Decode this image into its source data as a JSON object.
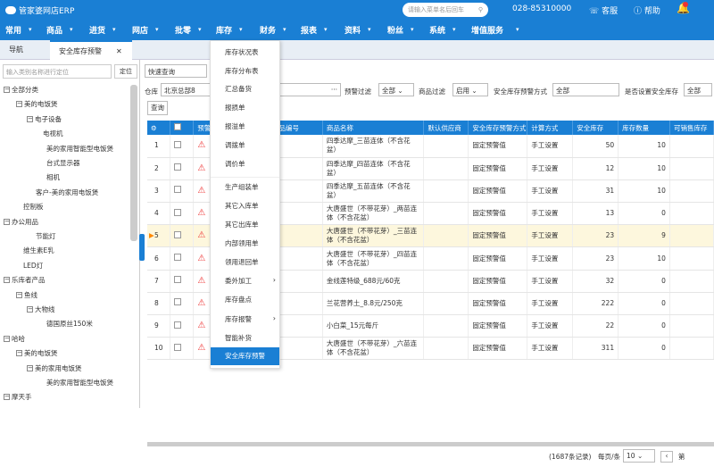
{
  "app": {
    "logo": "管家婆网店ERP",
    "search_placeholder": "请输入菜单名后回车",
    "phone": "028-85310000",
    "service": "客服",
    "help": "帮助"
  },
  "menu": [
    "常用",
    "商品",
    "进货",
    "网店",
    "批零",
    "库存",
    "财务",
    "报表",
    "资料",
    "粉丝",
    "系统",
    "增值服务"
  ],
  "tabs": {
    "nav": "导航",
    "active": "安全库存预警"
  },
  "left": {
    "search_placeholder": "输入类别名称进行定位",
    "locate": "定位",
    "tree": [
      "全部分类",
      "美的电饭煲",
      "电子设备",
      "电视机",
      "美的家用智能型电饭煲",
      "台式显示器",
      "相机",
      "客户-美的家用电饭煲",
      "控制板",
      "办公用品",
      "节能灯",
      "维生素E乳",
      "LED灯",
      "乐库者产品",
      "鱼线",
      "大物线",
      "德国原丝150米",
      "哈哈",
      "美的电饭煲",
      "美的家用电饭煲",
      "美的家用智能型电饭煲",
      "摩天手"
    ]
  },
  "filters": {
    "query_mode": "快速查询",
    "warehouse_label": "仓库",
    "warehouse": "北京总部8",
    "warn_filter_label": "预警过滤",
    "warn_filter": "全部",
    "product_filter_label": "商品过滤",
    "product_filter": "启用",
    "method_label": "安全库存预警方式",
    "method": "全部",
    "set_label": "是否设置安全库存",
    "set_value": "全部",
    "query_btn": "查询"
  },
  "table": {
    "headers": [
      "",
      "",
      "预警",
      "",
      "商品编号",
      "商品名称",
      "默认供应商",
      "安全库存预警方式",
      "计算方式",
      "安全库存",
      "库存数量",
      "可销售库存"
    ],
    "rows": [
      {
        "n": "1",
        "name": "四季达摩_三苗连体（不含花盆）",
        "method": "固定预警值",
        "calc": "手工设置",
        "safe": "50",
        "qty": "10"
      },
      {
        "n": "2",
        "name": "四季达摩_四苗连体（不含花盆）",
        "method": "固定预警值",
        "calc": "手工设置",
        "safe": "12",
        "qty": "10"
      },
      {
        "n": "3",
        "name": "四季达摩_五苗连体（不含花盆）",
        "method": "固定预警值",
        "calc": "手工设置",
        "safe": "31",
        "qty": "10"
      },
      {
        "n": "4",
        "name": "大唐盛世（不带花芽）_两苗连体（不含花盆）",
        "method": "固定预警值",
        "calc": "手工设置",
        "safe": "13",
        "qty": "0"
      },
      {
        "n": "5",
        "name": "大唐盛世（不带花芽）_三苗连体（不含花盆）",
        "method": "固定预警值",
        "calc": "手工设置",
        "safe": "23",
        "qty": "9"
      },
      {
        "n": "6",
        "name": "大唐盛世（不带花芽）_四苗连体（不含花盆）",
        "method": "固定预警值",
        "calc": "手工设置",
        "safe": "23",
        "qty": "10"
      },
      {
        "n": "7",
        "name": "金线莲特级_688元/60克",
        "method": "固定预警值",
        "calc": "手工设置",
        "safe": "32",
        "qty": "0"
      },
      {
        "n": "8",
        "name": "兰花营养土_8.8元/250克",
        "method": "固定预警值",
        "calc": "手工设置",
        "safe": "222",
        "qty": "0"
      },
      {
        "n": "9",
        "name": "小白菜_15元每斤",
        "method": "固定预警值",
        "calc": "手工设置",
        "safe": "22",
        "qty": "0"
      },
      {
        "n": "10",
        "name": "大唐盛世（不带花芽）_六苗连体（不含花盆）",
        "method": "固定预警值",
        "calc": "手工设置",
        "safe": "311",
        "qty": "0"
      }
    ]
  },
  "footer": {
    "records": "(1687条记录)",
    "per_page_label": "每页/条",
    "per_page": "10",
    "next": "第"
  },
  "dropdown": [
    "库存状况表",
    "库存分布表",
    "汇总备货",
    "报损单",
    "报溢单",
    "调拨单",
    "调价单",
    "生产组装单",
    "其它入库单",
    "其它出库单",
    "内部领用单",
    "领用退回单",
    "委外加工",
    "库存盘点",
    "库存报警",
    "智能补货",
    "安全库存预警"
  ]
}
